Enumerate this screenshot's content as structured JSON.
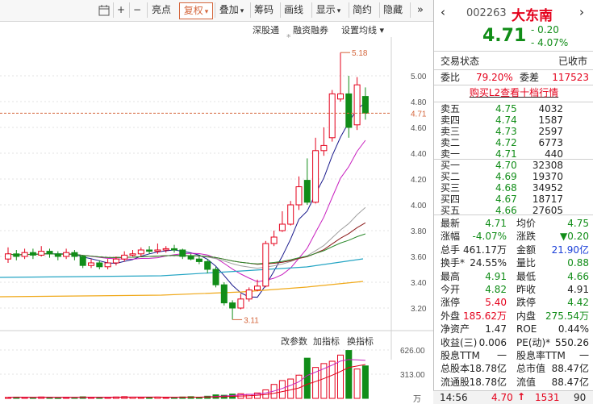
{
  "toolbar": {
    "icons": [
      "calendar-icon",
      "plus-icon",
      "minus-icon"
    ],
    "buttons": [
      {
        "label": "亮点",
        "arrow": ""
      },
      {
        "label": "复权",
        "arrow": "▾"
      },
      {
        "label": "叠加",
        "arrow": "▾"
      },
      {
        "label": "筹码",
        "arrow": ""
      },
      {
        "label": "画线",
        "arrow": ""
      },
      {
        "label": "显示",
        "arrow": "▾"
      },
      {
        "label": "简约",
        "arrow": ""
      },
      {
        "label": "隐藏",
        "arrow": ""
      }
    ],
    "more_icon": "double-chevron-right-icon"
  },
  "subbar": {
    "items": [
      "深股通",
      "融资融券",
      "设置均线 ▾"
    ],
    "marker": "*"
  },
  "chart_data": {
    "type": "candlestick",
    "y_ticks": [
      "5.00",
      "4.80",
      "4.60",
      "4.40",
      "4.20",
      "4.00",
      "3.80",
      "3.60",
      "3.40",
      "3.20"
    ],
    "current_price_label": "4.71",
    "high_annotation": "5.18",
    "low_annotation": "3.11",
    "candles": [
      [
        3.58,
        3.62,
        3.67,
        3.55
      ],
      [
        3.62,
        3.6,
        3.65,
        3.57
      ],
      [
        3.6,
        3.63,
        3.66,
        3.58
      ],
      [
        3.63,
        3.61,
        3.66,
        3.58
      ],
      [
        3.61,
        3.64,
        3.68,
        3.6
      ],
      [
        3.64,
        3.62,
        3.66,
        3.59
      ],
      [
        3.62,
        3.6,
        3.64,
        3.57
      ],
      [
        3.6,
        3.63,
        3.66,
        3.58
      ],
      [
        3.63,
        3.6,
        3.65,
        3.57
      ],
      [
        3.6,
        3.53,
        3.61,
        3.51
      ],
      [
        3.53,
        3.55,
        3.58,
        3.51
      ],
      [
        3.55,
        3.52,
        3.57,
        3.5
      ],
      [
        3.52,
        3.55,
        3.58,
        3.5
      ],
      [
        3.55,
        3.58,
        3.6,
        3.53
      ],
      [
        3.58,
        3.61,
        3.64,
        3.56
      ],
      [
        3.61,
        3.62,
        3.65,
        3.6
      ],
      [
        3.62,
        3.65,
        3.67,
        3.6
      ],
      [
        3.65,
        3.64,
        3.68,
        3.62
      ],
      [
        3.64,
        3.65,
        3.7,
        3.62
      ],
      [
        3.65,
        3.66,
        3.68,
        3.63
      ],
      [
        3.66,
        3.65,
        3.69,
        3.63
      ],
      [
        3.65,
        3.6,
        3.66,
        3.58
      ],
      [
        3.6,
        3.58,
        3.62,
        3.57
      ],
      [
        3.58,
        3.56,
        3.6,
        3.54
      ],
      [
        3.56,
        3.5,
        3.58,
        3.47
      ],
      [
        3.5,
        3.38,
        3.52,
        3.36
      ],
      [
        3.38,
        3.24,
        3.4,
        3.22
      ],
      [
        3.24,
        3.2,
        3.26,
        3.11
      ],
      [
        3.2,
        3.27,
        3.31,
        3.19
      ],
      [
        3.27,
        3.34,
        3.36,
        3.25
      ],
      [
        3.34,
        3.37,
        3.42,
        3.33
      ],
      [
        3.37,
        3.7,
        3.72,
        3.36
      ],
      [
        3.7,
        3.75,
        3.8,
        3.68
      ],
      [
        3.8,
        3.85,
        3.95,
        3.79
      ],
      [
        3.85,
        4.0,
        4.03,
        3.84
      ],
      [
        4.0,
        4.14,
        4.22,
        3.96
      ],
      [
        4.19,
        4.02,
        4.36,
        4.0
      ],
      [
        4.02,
        4.42,
        4.52,
        4.01
      ],
      [
        4.42,
        4.46,
        4.6,
        4.38
      ],
      [
        4.52,
        4.86,
        4.89,
        4.49
      ],
      [
        4.82,
        4.86,
        5.18,
        4.8
      ],
      [
        4.86,
        4.6,
        5.0,
        4.52
      ],
      [
        4.62,
        4.93,
        4.99,
        4.58
      ],
      [
        4.84,
        4.71,
        4.91,
        4.66
      ]
    ],
    "volume_ticks": [
      "626.00",
      "313.00",
      "万"
    ],
    "volumes": [
      12,
      16,
      14,
      10,
      18,
      12,
      9,
      14,
      11,
      20,
      14,
      12,
      15,
      18,
      22,
      16,
      13,
      14,
      17,
      12,
      10,
      18,
      22,
      15,
      28,
      45,
      40,
      55,
      60,
      52,
      70,
      110,
      180,
      230,
      250,
      300,
      520,
      400,
      450,
      480,
      560,
      620,
      380,
      420
    ]
  },
  "volume_header": {
    "items": [
      "改参数",
      "加指标",
      "换指标"
    ]
  },
  "quote": {
    "code": "002263",
    "name": "大东南",
    "price": "4.71",
    "change": "- 0.20",
    "change_pct": "- 4.07%",
    "trade_status_label": "交易状态",
    "trade_status_value": "已收市",
    "weibi_label": "委比",
    "weibi_value": "79.20%",
    "weicha_label": "委差",
    "weicha_value": "117523",
    "l2_link": "购买L2查看十档行情",
    "sells": [
      {
        "label": "卖五",
        "price": "4.75",
        "vol": "4032"
      },
      {
        "label": "卖四",
        "price": "4.74",
        "vol": "1587"
      },
      {
        "label": "卖三",
        "price": "4.73",
        "vol": "2597"
      },
      {
        "label": "卖二",
        "price": "4.72",
        "vol": "6773"
      },
      {
        "label": "卖一",
        "price": "4.71",
        "vol": "440"
      }
    ],
    "buys": [
      {
        "label": "买一",
        "price": "4.70",
        "vol": "32308"
      },
      {
        "label": "买二",
        "price": "4.69",
        "vol": "19370"
      },
      {
        "label": "买三",
        "price": "4.68",
        "vol": "34952"
      },
      {
        "label": "买四",
        "price": "4.67",
        "vol": "18717"
      },
      {
        "label": "买五",
        "price": "4.66",
        "vol": "27605"
      }
    ],
    "stats": [
      {
        "l1": "最新",
        "v1": "4.71",
        "c1": "green",
        "l2": "均价",
        "v2": "4.75",
        "c2": "green"
      },
      {
        "l1": "涨幅",
        "v1": "-4.07%",
        "c1": "green",
        "l2": "涨跌",
        "v2": "▼0.20",
        "c2": "green"
      },
      {
        "l1": "总手",
        "v1": "461.17万",
        "c1": "dark",
        "l2": "金额",
        "v2": "21.90亿",
        "c2": "blue"
      },
      {
        "l1": "换手*",
        "v1": "24.55%",
        "c1": "dark",
        "l2": "量比",
        "v2": "0.88",
        "c2": "green"
      },
      {
        "l1": "最高",
        "v1": "4.91",
        "c1": "green",
        "l2": "最低",
        "v2": "4.66",
        "c2": "green"
      },
      {
        "l1": "今开",
        "v1": "4.82",
        "c1": "green",
        "l2": "昨收",
        "v2": "4.91",
        "c2": "dark"
      },
      {
        "l1": "涨停",
        "v1": "5.40",
        "c1": "red",
        "l2": "跌停",
        "v2": "4.42",
        "c2": "green"
      },
      {
        "l1": "外盘",
        "v1": "185.62万",
        "c1": "red",
        "l2": "内盘",
        "v2": "275.54万",
        "c2": "green"
      },
      {
        "l1": "净资产",
        "v1": "1.47",
        "c1": "dark",
        "l2": "ROE",
        "v2": "0.44%",
        "c2": "dark"
      },
      {
        "l1": "收益(三)",
        "v1": "0.006",
        "c1": "dark",
        "l2": "PE(动)*",
        "v2": "550.26",
        "c2": "dark"
      },
      {
        "l1": "股息TTM",
        "v1": "一",
        "c1": "dark",
        "l2": "股息率TTM",
        "v2": "一",
        "c2": "dark"
      },
      {
        "l1": "总股本",
        "v1": "18.78亿",
        "c1": "dark",
        "l2": "总市值",
        "v2": "88.47亿",
        "c2": "dark"
      },
      {
        "l1": "流通股",
        "v1": "18.78亿",
        "c1": "dark",
        "l2": "流值",
        "v2": "88.47亿",
        "c2": "dark"
      }
    ]
  },
  "status": {
    "time": "14:56",
    "price": "4.70",
    "arrow": "↑",
    "vol": "1531",
    "count": "90"
  },
  "colors": {
    "up": "#e4001b",
    "down": "#118d18",
    "ma5": "#ffffff",
    "accent": "#d4663c"
  }
}
